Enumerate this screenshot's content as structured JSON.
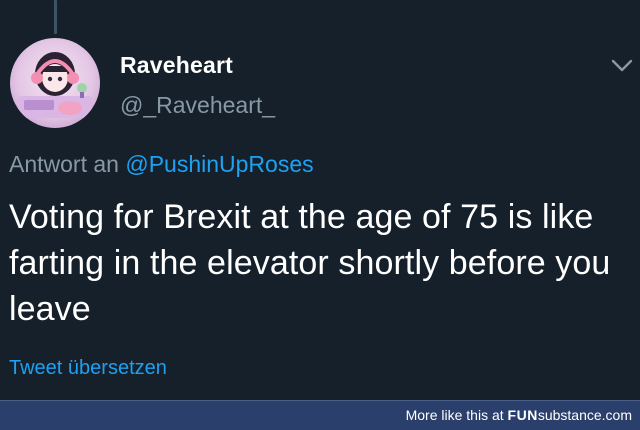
{
  "tweet": {
    "display_name": "Raveheart",
    "handle": "@_Raveheart_",
    "reply_prefix": "Antwort an",
    "reply_mention": "@PushinUpRoses",
    "text": "Voting for Brexit at the age of 75 is like farting in the elevator shortly before you leave",
    "translate_label": "Tweet übersetzen",
    "avatar_icon": "anime-girl-avatar-icon",
    "menu_icon": "chevron-down-icon"
  },
  "footer": {
    "prefix": "More like this at",
    "brand_fun": "FUN",
    "brand_sub": "substance",
    "brand_tld": ".com"
  },
  "colors": {
    "background": "#15202b",
    "name": "#ffffff",
    "muted": "#8899a6",
    "link": "#1da1f2",
    "footer_bar": "#2a3f6b"
  }
}
